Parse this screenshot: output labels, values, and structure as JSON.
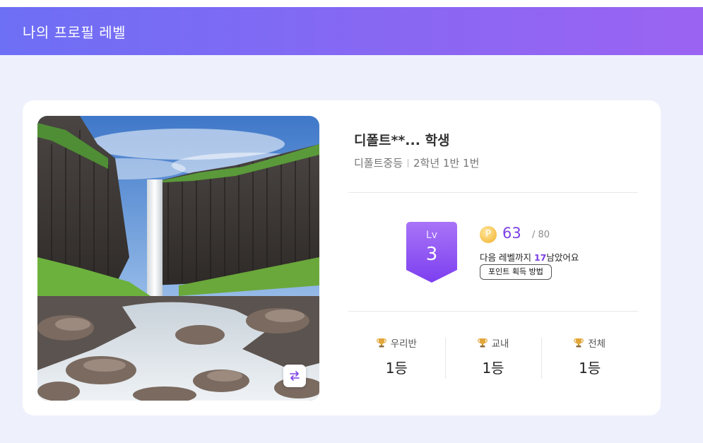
{
  "header": {
    "title": "나의 프로필 레벨"
  },
  "profile": {
    "name": "디폴트**... 학생",
    "school": "디폴트중등",
    "class_info": "2학년 1반 1번",
    "photo_label": "waterfall-photo"
  },
  "level": {
    "label": "Lv",
    "value": "3",
    "badge_color": "#8b5cf6"
  },
  "points": {
    "coin_symbol": "P",
    "current": "63",
    "max": "/ 80",
    "next_prefix": "다음 레벨까지 ",
    "next_remaining": "17",
    "next_suffix": "남았어요",
    "how_button": "포인트 획득 방법"
  },
  "ranks": [
    {
      "label": "우리반",
      "value": "1등"
    },
    {
      "label": "교내",
      "value": "1등"
    },
    {
      "label": "전체",
      "value": "1등"
    }
  ],
  "colors": {
    "accent": "#7b3fe4",
    "header_start": "#6d6ff5",
    "header_end": "#9b63f2",
    "background": "#eef1fc"
  }
}
